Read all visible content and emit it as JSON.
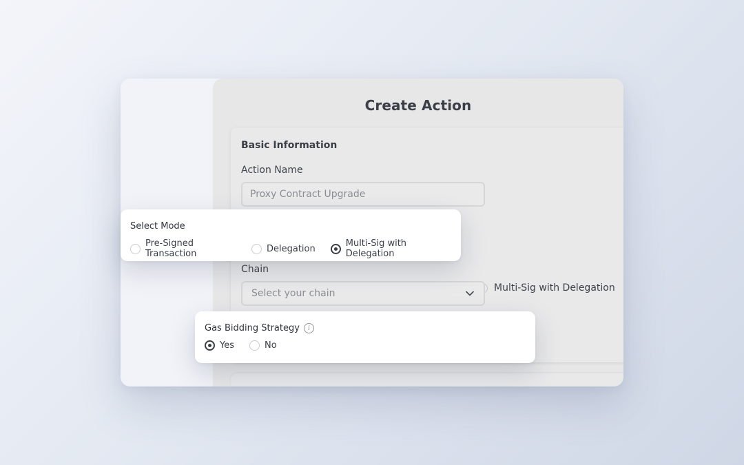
{
  "page": {
    "title": "Create Action"
  },
  "basic_info": {
    "section_title": "Basic Information",
    "action_name_label": "Action Name",
    "action_name_value": "Proxy Contract Upgrade",
    "background_radio_label": "Multi-Sig with Delegation",
    "chain_label": "Chain",
    "chain_placeholder": "Select your chain"
  },
  "select_mode": {
    "label": "Select Mode",
    "options": [
      "Pre-Signed Transaction",
      "Delegation",
      "Multi-Sig with Delegation"
    ],
    "selected": "Multi-Sig with Delegation"
  },
  "gas_bidding": {
    "label": "Gas Bidding Strategy",
    "info_icon": "info-icon",
    "options": [
      "Yes",
      "No"
    ],
    "selected": "Yes"
  },
  "colors": {
    "accent": "#3a3d45",
    "panel": "#e7e7e8",
    "popup": "#ffffff"
  }
}
